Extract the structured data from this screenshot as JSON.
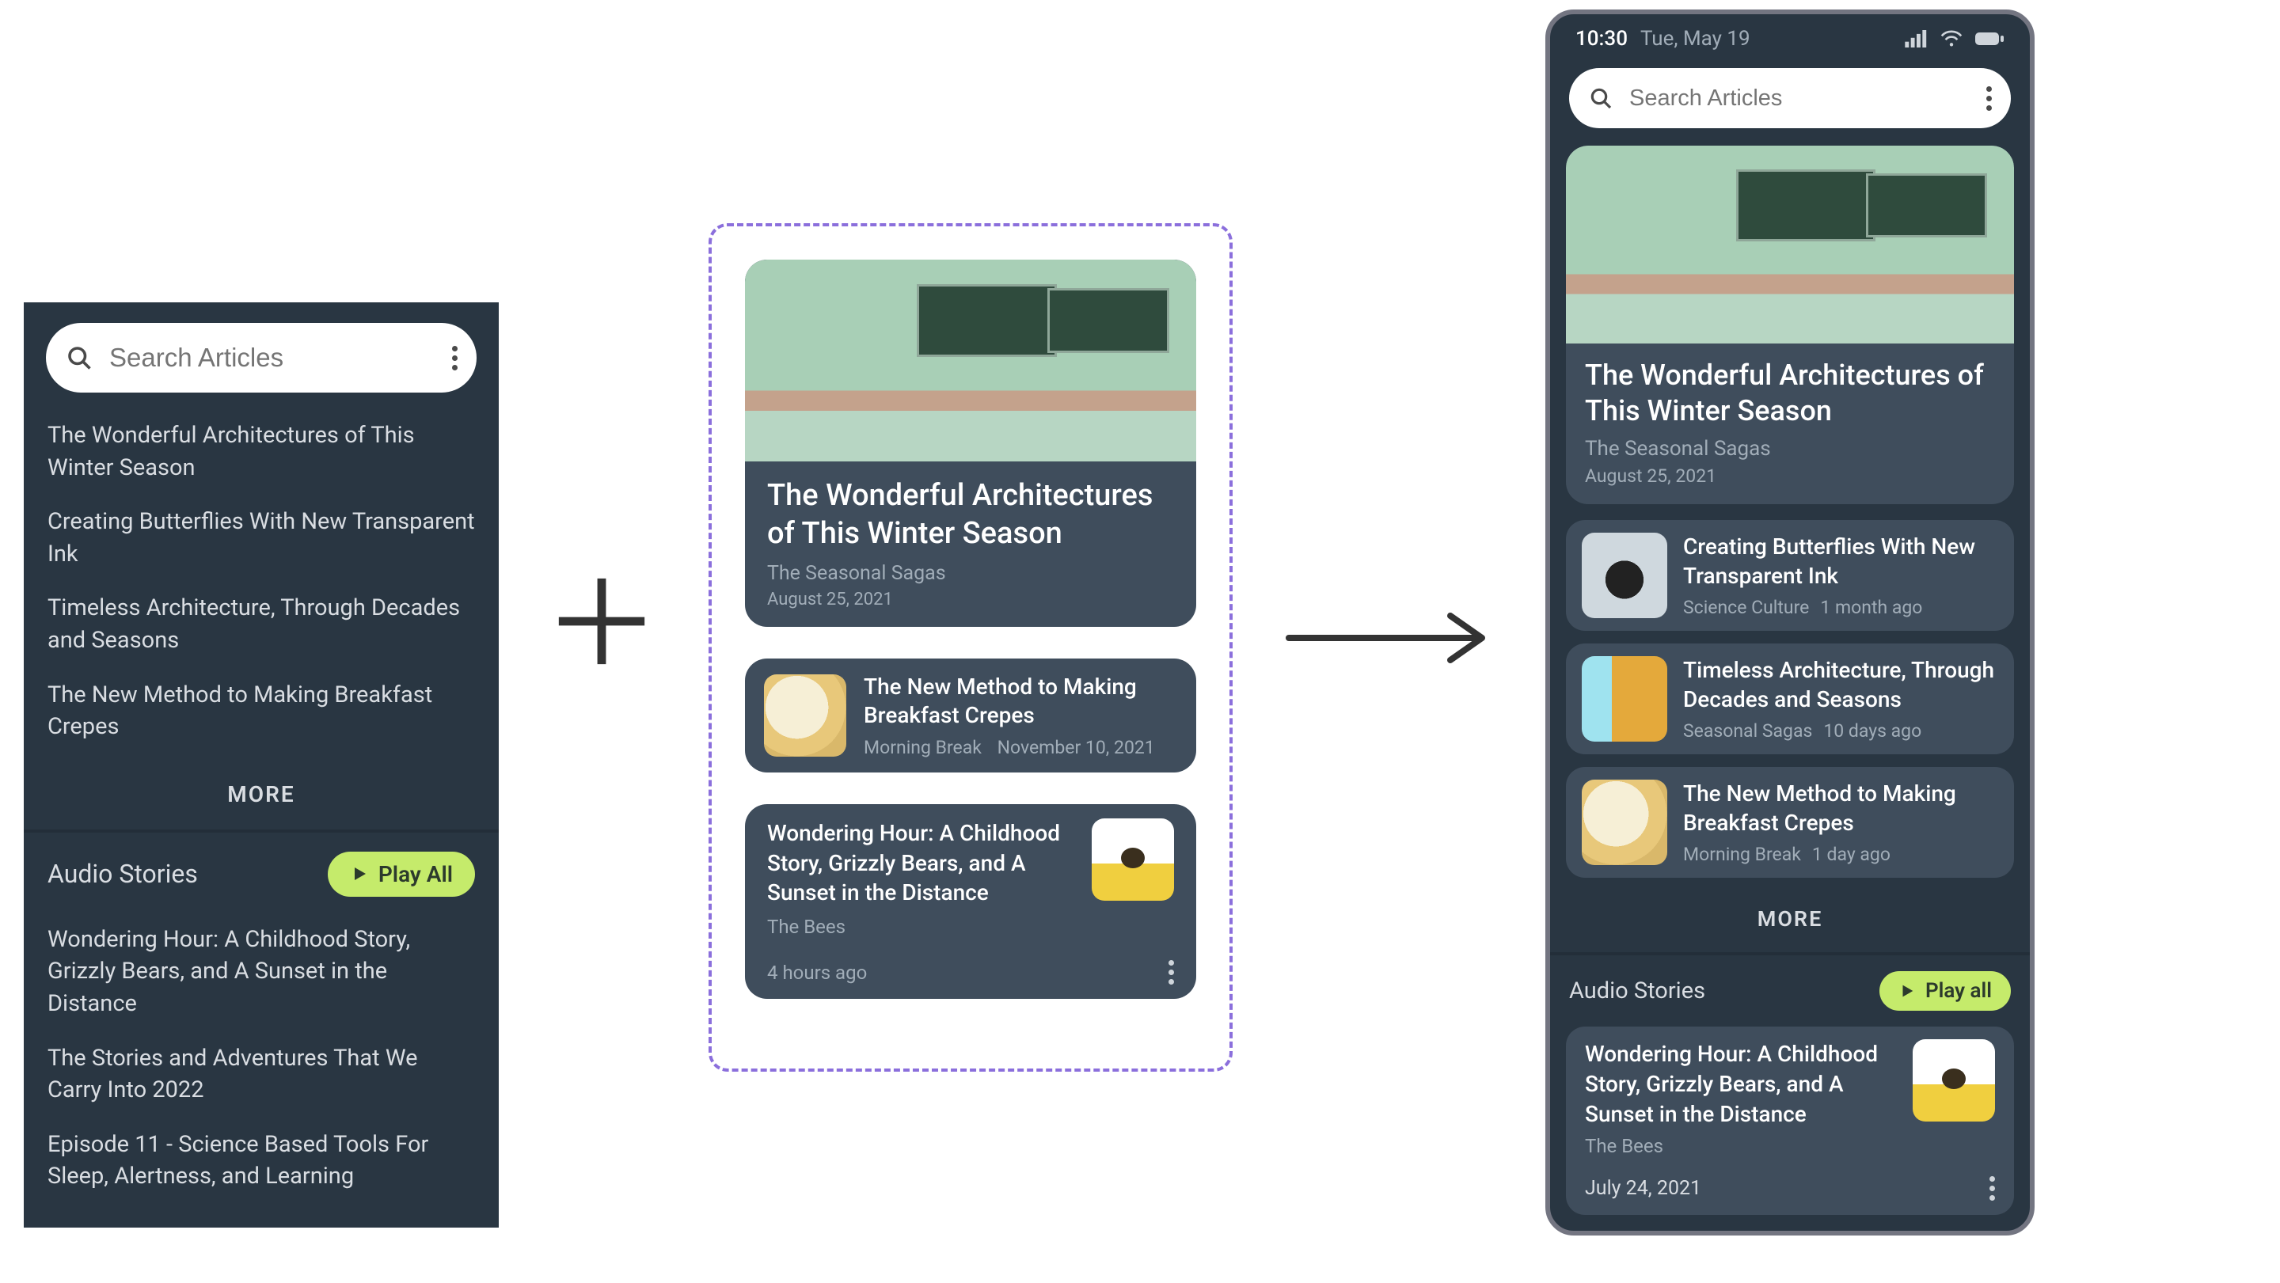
{
  "search": {
    "placeholder": "Search Articles"
  },
  "statusbar": {
    "time": "10:30",
    "date": "Tue, May 19"
  },
  "more_label": "MORE",
  "audio_section_title": "Audio Stories",
  "play_all_label_a": "Play All",
  "play_all_label_c": "Play all",
  "panelA": {
    "articles": [
      "The Wonderful Architectures of This Winter Season",
      "Creating Butterflies With New Transparent Ink",
      "Timeless Architecture, Through Decades and Seasons",
      "The New Method to Making Breakfast Crepes"
    ],
    "audio": [
      "Wondering Hour: A Childhood Story, Grizzly Bears, and A Sunset in the Distance",
      "The Stories and Adventures That We Carry Into 2022",
      "Episode 11 - Science Based Tools For Sleep, Alertness, and Learning"
    ]
  },
  "panelB": {
    "hero": {
      "title": "The Wonderful Architectures of This Winter Season",
      "source": "The Seasonal Sagas",
      "date": "August 25, 2021"
    },
    "row1": {
      "title": "The New Method to Making Breakfast Crepes",
      "source": "Morning Break",
      "date": "November 10, 2021"
    },
    "row2": {
      "title": "Wondering Hour: A Childhood Story, Grizzly Bears, and A Sunset in the Distance",
      "source": "The Bees",
      "date": "4 hours ago"
    }
  },
  "panelC": {
    "hero": {
      "title": "The Wonderful Architectures of This Winter Season",
      "source": "The Seasonal Sagas",
      "date": "August 25, 2021"
    },
    "rows": [
      {
        "title": "Creating Butterflies With New Transparent Ink",
        "source": "Science Culture",
        "date": "1 month ago"
      },
      {
        "title": "Timeless Architecture, Through Decades and Seasons",
        "source": "Seasonal Sagas",
        "date": "10 days ago"
      },
      {
        "title": "The New Method to Making Breakfast Crepes",
        "source": "Morning Break",
        "date": "1 day ago"
      }
    ],
    "audio": {
      "title": "Wondering Hour: A Childhood Story, Grizzly Bears, and A Sunset in the Distance",
      "source": "The Bees",
      "date": "July 24, 2021"
    }
  }
}
